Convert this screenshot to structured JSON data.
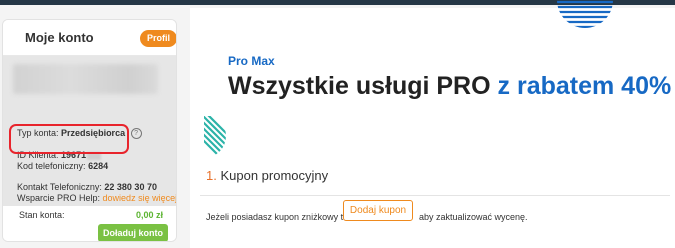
{
  "sidebar": {
    "title": "Moje konto",
    "badge": "Profil",
    "account_type_label": "Typ konta:",
    "account_type_value": "Przedsiębiorca",
    "client_id_label": "ID Klienta:",
    "client_id_value": "19671",
    "phone_code_label": "Kod telefoniczny:",
    "phone_code_value": "6284",
    "contact_phone_label": "Kontakt Telefoniczny:",
    "contact_phone_value": "22 380 30 70",
    "pro_help_label": "Wsparcie PRO Help:",
    "pro_help_link": "dowiedz się więcej",
    "balance_label": "Stan konta:",
    "balance_value": "0,00 zł",
    "topup_button": "Doładuj konto"
  },
  "main": {
    "promo_label": "Pro Max",
    "headline_main": "Wszystkie usługi PRO",
    "headline_accent": "z rabatem 40%",
    "section_number": "1.",
    "section_title": "Kupon promocyjny",
    "coupon_text_before": "Jeżeli posiadasz kupon zniżkowy to:",
    "coupon_button": "Dodaj kupon",
    "coupon_text_after": "aby zaktualizować wycenę."
  },
  "colors": {
    "accent_blue": "#1769c4",
    "accent_orange": "#ef8a1e",
    "green": "#7ac143",
    "highlight_red": "#e8242c",
    "teal_deco": "#2bb3a8"
  }
}
